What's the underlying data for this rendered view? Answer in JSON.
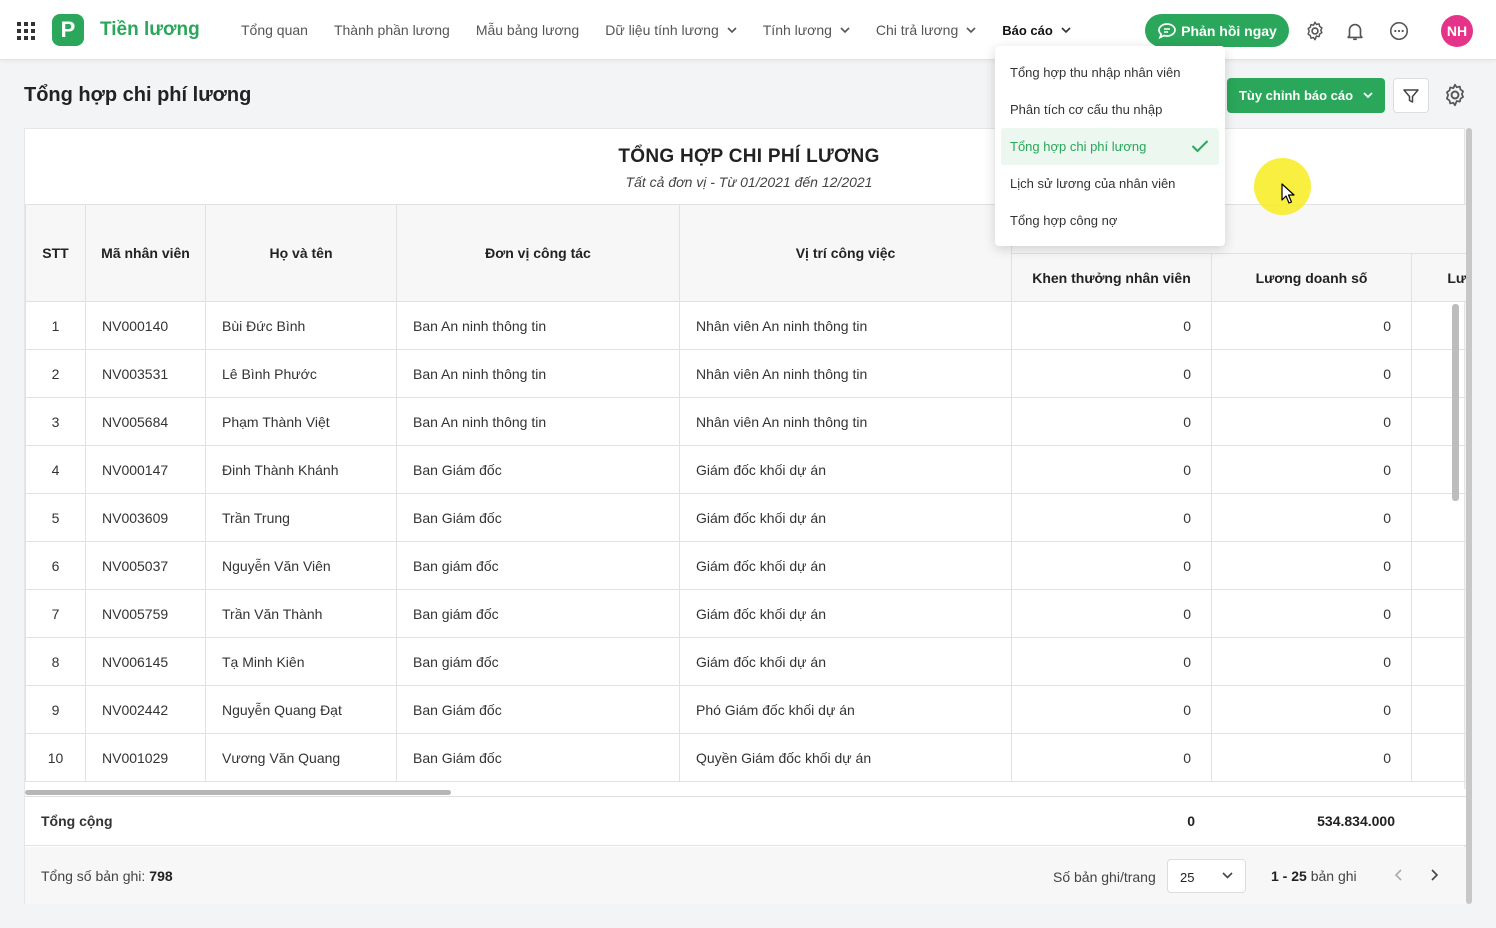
{
  "app": {
    "title": "Tiền lương",
    "logo_letter": "P",
    "brand_color": "#2aa75a"
  },
  "nav": [
    {
      "label": "Tổng quan",
      "dropdown": false
    },
    {
      "label": "Thành phần lương",
      "dropdown": false
    },
    {
      "label": "Mẫu bảng lương",
      "dropdown": false
    },
    {
      "label": "Dữ liệu tính lương",
      "dropdown": true
    },
    {
      "label": "Tính lương",
      "dropdown": true
    },
    {
      "label": "Chi trả lương",
      "dropdown": true
    },
    {
      "label": "Báo cáo",
      "dropdown": true,
      "active": true
    }
  ],
  "topbar": {
    "feedback_label": "Phản hồi ngay",
    "avatar_initials": "NH",
    "icons": [
      "settings-icon",
      "bell-icon",
      "chat-icon"
    ]
  },
  "page": {
    "title": "Tổng hợp chi phí lương",
    "custom_report_label": "Tùy chỉnh báo cáo"
  },
  "report": {
    "title": "TỔNG HỢP CHI PHÍ LƯƠNG",
    "subtitle": "Tất cả đơn vị - Từ 01/2021 đến 12/2021",
    "columns": {
      "stt": "STT",
      "code": "Mã nhân viên",
      "name": "Họ và tên",
      "unit": "Đơn vị công tác",
      "position": "Vị trí công việc",
      "bonus": "Khen thưởng nhân viên",
      "sales": "Lương doanh số",
      "next": "Lư"
    },
    "rows": [
      {
        "stt": "1",
        "code": "NV000140",
        "name": "Bùi Đức Bình",
        "unit": "Ban An ninh thông tin",
        "position": "Nhân viên An ninh thông tin",
        "bonus": "0",
        "sales": "0"
      },
      {
        "stt": "2",
        "code": "NV003531",
        "name": "Lê Bình Phước",
        "unit": "Ban An ninh thông tin",
        "position": "Nhân viên An ninh thông tin",
        "bonus": "0",
        "sales": "0"
      },
      {
        "stt": "3",
        "code": "NV005684",
        "name": "Phạm Thành Việt",
        "unit": "Ban An ninh thông tin",
        "position": "Nhân viên An ninh thông tin",
        "bonus": "0",
        "sales": "0"
      },
      {
        "stt": "4",
        "code": "NV000147",
        "name": "Đinh Thành Khánh",
        "unit": "Ban Giám đốc",
        "position": "Giám đốc khối dự án",
        "bonus": "0",
        "sales": "0"
      },
      {
        "stt": "5",
        "code": "NV003609",
        "name": "Trần Trung",
        "unit": "Ban Giám đốc",
        "position": "Giám đốc khối dự án",
        "bonus": "0",
        "sales": "0"
      },
      {
        "stt": "6",
        "code": "NV005037",
        "name": "Nguyễn Văn Viên",
        "unit": "Ban giám đốc",
        "position": "Giám đốc khối dự án",
        "bonus": "0",
        "sales": "0"
      },
      {
        "stt": "7",
        "code": "NV005759",
        "name": "Trần Văn Thành",
        "unit": "Ban giám đốc",
        "position": "Giám đốc khối dự án",
        "bonus": "0",
        "sales": "0"
      },
      {
        "stt": "8",
        "code": "NV006145",
        "name": "Tạ Minh Kiên",
        "unit": "Ban giám đốc",
        "position": "Giám đốc khối dự án",
        "bonus": "0",
        "sales": "0"
      },
      {
        "stt": "9",
        "code": "NV002442",
        "name": "Nguyễn Quang Đạt",
        "unit": "Ban Giám đốc",
        "position": "Phó Giám đốc khối dự án",
        "bonus": "0",
        "sales": "0"
      },
      {
        "stt": "10",
        "code": "NV001029",
        "name": "Vương Văn Quang",
        "unit": "Ban Giám đốc",
        "position": "Quyền Giám đốc khối dự án",
        "bonus": "0",
        "sales": "0"
      }
    ],
    "total": {
      "label": "Tổng cộng",
      "bonus": "0",
      "sales": "534.834.000"
    }
  },
  "footer": {
    "records_label": "Tổng số bản ghi:",
    "records_count": "798",
    "per_page_label": "Số bản ghi/trang",
    "per_page_value": "25",
    "range_bold": "1 - 25",
    "range_suffix": "bản ghi"
  },
  "dropdown": {
    "items": [
      {
        "label": "Tổng hợp thu nhập nhân viên",
        "selected": false
      },
      {
        "label": "Phân tích cơ cấu thu nhập",
        "selected": false
      },
      {
        "label": "Tổng hợp chi phí lương",
        "selected": true
      },
      {
        "label": "Lịch sử lương của nhân viên",
        "selected": false
      },
      {
        "label": "Tổng hợp công nợ",
        "selected": false
      }
    ]
  }
}
